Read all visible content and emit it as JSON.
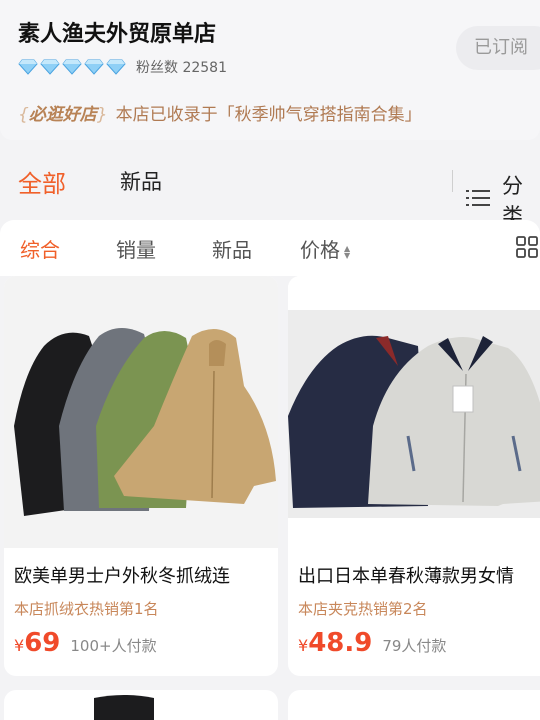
{
  "shop": {
    "name": "素人渔夫外贸原单店",
    "fans_label": "粉丝数 22581",
    "follow_label": "已订阅",
    "diamond_count": 5,
    "promo_badge": "必逛好店",
    "promo_text": "本店已收录于「秋季帅气穿搭指南合集」"
  },
  "category_tabs": [
    {
      "label": "全部",
      "active": true
    },
    {
      "label": "新品",
      "active": false
    }
  ],
  "category_menu_label": "分类",
  "sort_tabs": [
    {
      "label": "综合",
      "active": true
    },
    {
      "label": "销量",
      "active": false
    },
    {
      "label": "新品",
      "active": false
    },
    {
      "label": "价格",
      "active": false
    }
  ],
  "icons": {
    "diamond": "diamond-icon",
    "menu": "list-menu-icon",
    "sort": "sort-arrows-icon",
    "layout": "grid-layout-icon"
  },
  "colors": {
    "accent": "#f0602a",
    "price": "#f04a2a",
    "promo": "#b07a52",
    "diamond": "#7cc4f2"
  },
  "products": [
    {
      "title": "欧美单男士户外秋冬抓绒连",
      "rank": "本店抓绒衣热销第1名",
      "currency": "¥",
      "price": "69",
      "sold": "100+人付款"
    },
    {
      "title": "出口日本单春秋薄款男女情",
      "rank": "本店夹克热销第2名",
      "currency": "¥",
      "price": "48.9",
      "sold": "79人付款"
    }
  ]
}
